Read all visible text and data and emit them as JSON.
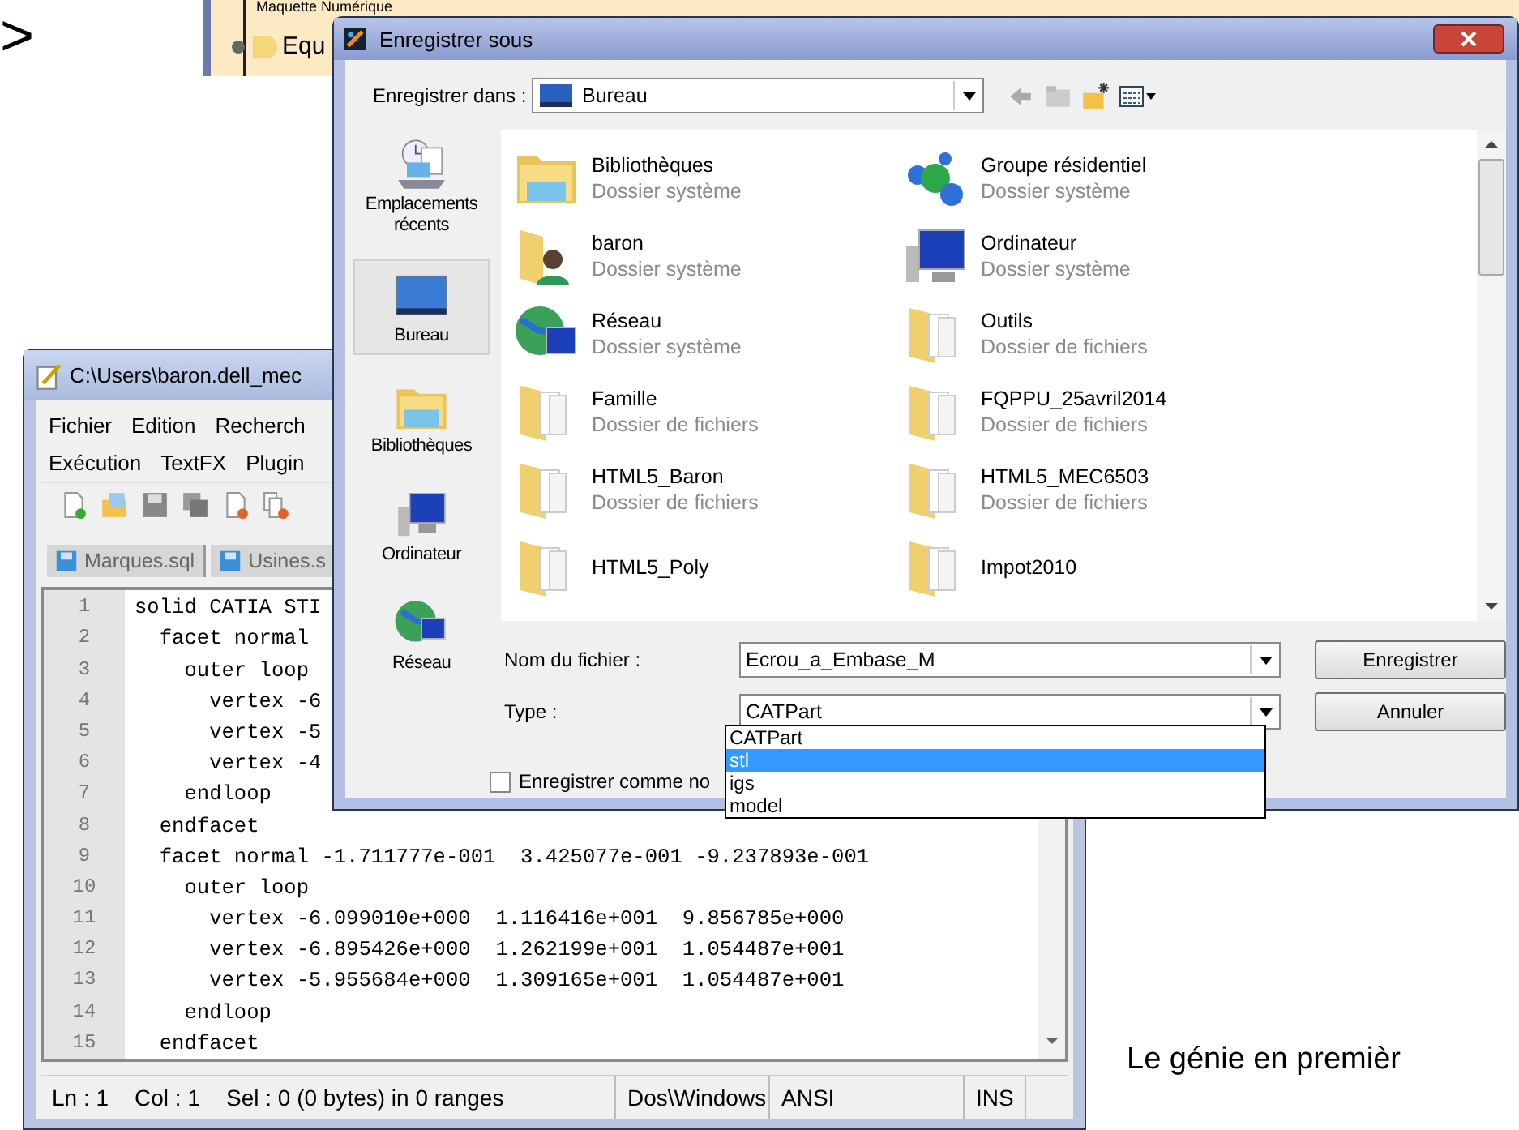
{
  "heading_mark": ">",
  "background_window": {
    "tree_items": [
      {
        "label": "Maquette Numérique"
      },
      {
        "label": "Equ"
      }
    ]
  },
  "notepad": {
    "title": "C:\\Users\\baron.dell_mec",
    "menu_rows": [
      [
        "Fichier",
        "Edition",
        "Recherch"
      ],
      [
        "Exécution",
        "TextFX",
        "Plugin"
      ]
    ],
    "tabs": [
      {
        "label": "Marques.sql"
      },
      {
        "label": "Usines.s"
      }
    ],
    "lines": [
      {
        "number": "1",
        "text": "solid CATIA STI"
      },
      {
        "number": "2",
        "text": "  facet normal"
      },
      {
        "number": "3",
        "text": "    outer loop"
      },
      {
        "number": "4",
        "text": "      vertex -6"
      },
      {
        "number": "5",
        "text": "      vertex -5"
      },
      {
        "number": "6",
        "text": "      vertex -4"
      },
      {
        "number": "7",
        "text": "    endloop"
      },
      {
        "number": "8",
        "text": "  endfacet"
      },
      {
        "number": "9",
        "text": "  facet normal -1.711777e-001  3.425077e-001 -9.237893e-001"
      },
      {
        "number": "10",
        "text": "    outer loop"
      },
      {
        "number": "11",
        "text": "      vertex -6.099010e+000  1.116416e+001  9.856785e+000"
      },
      {
        "number": "12",
        "text": "      vertex -6.895426e+000  1.262199e+001  1.054487e+001"
      },
      {
        "number": "13",
        "text": "      vertex -5.955684e+000  1.309165e+001  1.054487e+001"
      },
      {
        "number": "14",
        "text": "    endloop"
      },
      {
        "number": "15",
        "text": "  endfacet"
      }
    ],
    "status_bar": [
      "Ln : 1",
      "Col : 1",
      "Sel : 0 (0 bytes) in 0 ranges",
      "Dos\\Windows",
      "ANSI",
      "INS"
    ]
  },
  "dialog": {
    "title": "Enregistrer sous",
    "save_in_label": "Enregistrer dans :",
    "save_in_value": "Bureau",
    "places": [
      {
        "label": "Emplacements récents",
        "kind": "recent",
        "selected": false
      },
      {
        "label": "Bureau",
        "kind": "desktop",
        "selected": true
      },
      {
        "label": "Bibliothèques",
        "kind": "library",
        "selected": false
      },
      {
        "label": "Ordinateur",
        "kind": "computer",
        "selected": false
      },
      {
        "label": "Réseau",
        "kind": "network",
        "selected": false
      }
    ],
    "files": [
      {
        "name": "Bibliothèques",
        "type": "Dossier système",
        "kind": "library"
      },
      {
        "name": "Groupe résidentiel",
        "type": "Dossier système",
        "kind": "homegroup"
      },
      {
        "name": "baron",
        "type": "Dossier système",
        "kind": "user"
      },
      {
        "name": "Ordinateur",
        "type": "Dossier système",
        "kind": "computer"
      },
      {
        "name": "Réseau",
        "type": "Dossier système",
        "kind": "network"
      },
      {
        "name": "Outils",
        "type": "Dossier de fichiers",
        "kind": "folder"
      },
      {
        "name": "Famille",
        "type": "Dossier de fichiers",
        "kind": "folder"
      },
      {
        "name": "FQPPU_25avril2014",
        "type": "Dossier de fichiers",
        "kind": "folder"
      },
      {
        "name": "HTML5_Baron",
        "type": "Dossier de fichiers",
        "kind": "folder"
      },
      {
        "name": "HTML5_MEC6503",
        "type": "Dossier de fichiers",
        "kind": "folder"
      },
      {
        "name": "HTML5_Poly",
        "kind": "folder"
      },
      {
        "name": "Impot2010",
        "kind": "folder"
      }
    ],
    "filename_label": "Nom du fichier :",
    "filename_value": "Ecrou_a_Embase_M",
    "type_label": "Type :",
    "type_value": "CATPart",
    "type_options": [
      {
        "label": "CATPart",
        "selected": false
      },
      {
        "label": "stl",
        "selected": true
      },
      {
        "label": "igs",
        "selected": false
      },
      {
        "label": "model",
        "selected": false
      }
    ],
    "buttons": [
      "Enregistrer",
      "Annuler"
    ],
    "checkbox": {
      "label": "Enregistrer comme no",
      "checked": false
    }
  },
  "footer_text": "Le génie en premièr"
}
